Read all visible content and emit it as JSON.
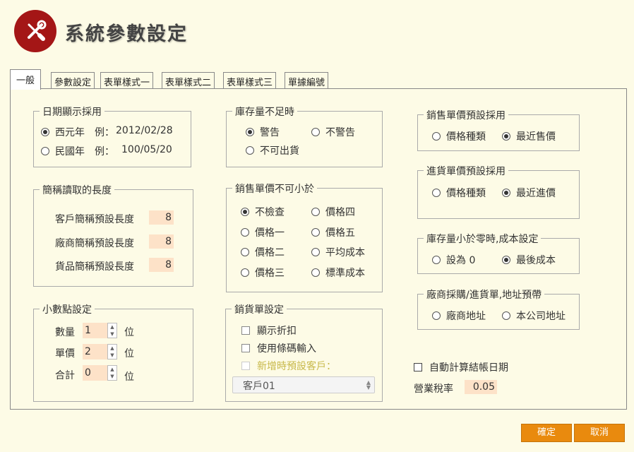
{
  "header": {
    "title": "系統參數設定",
    "logo_icon": "tools-icon",
    "logo_color": "#a41616"
  },
  "tabs": [
    "一般",
    "參數設定",
    "表單樣式一",
    "表單樣式二",
    "表單樣式三",
    "單據編號"
  ],
  "date_display": {
    "legend": "日期顯示採用",
    "options": [
      {
        "label": "西元年",
        "example_label": "例：",
        "example": "2012/02/28",
        "selected": true
      },
      {
        "label": "民國年",
        "example_label": "例：",
        "example": "100/05/20",
        "selected": false
      }
    ]
  },
  "short_name": {
    "legend": "簡稱讀取的長度",
    "rows": [
      {
        "label": "客戶簡稱預設長度",
        "value": "8"
      },
      {
        "label": "廠商簡稱預設長度",
        "value": "8"
      },
      {
        "label": "貨品簡稱預設長度",
        "value": "8"
      }
    ]
  },
  "decimal": {
    "legend": "小數點設定",
    "unit": "位",
    "rows": [
      {
        "label": "數量",
        "value": "1"
      },
      {
        "label": "單價",
        "value": "2"
      },
      {
        "label": "合計",
        "value": "0"
      }
    ]
  },
  "stock_short": {
    "legend": "庫存量不足時",
    "options": [
      {
        "label": "警告",
        "selected": true
      },
      {
        "label": "不警告",
        "selected": false
      },
      {
        "label": "不可出貨",
        "selected": false
      }
    ]
  },
  "min_price": {
    "legend": "銷售單價不可小於",
    "options": [
      {
        "label": "不檢查",
        "selected": true
      },
      {
        "label": "價格四",
        "selected": false
      },
      {
        "label": "價格一",
        "selected": false
      },
      {
        "label": "價格五",
        "selected": false
      },
      {
        "label": "價格二",
        "selected": false
      },
      {
        "label": "平均成本",
        "selected": false
      },
      {
        "label": "價格三",
        "selected": false
      },
      {
        "label": "標準成本",
        "selected": false
      }
    ]
  },
  "sales_doc": {
    "legend": "銷貨單設定",
    "checks": [
      {
        "label": "顯示折扣",
        "checked": false
      },
      {
        "label": "使用條碼輸入",
        "checked": false
      },
      {
        "label": "新增時預設客戶：",
        "checked": false,
        "disabled": true
      }
    ],
    "default_customer": "客戶01",
    "disabled_label_color": "#c8b94a"
  },
  "sale_price_default": {
    "legend": "銷售單價預設採用",
    "options": [
      {
        "label": "價格種類",
        "selected": false
      },
      {
        "label": "最近售價",
        "selected": true
      }
    ]
  },
  "purchase_price_default": {
    "legend": "進貨單價預設採用",
    "options": [
      {
        "label": "價格種類",
        "selected": false
      },
      {
        "label": "最近進價",
        "selected": true
      }
    ]
  },
  "negative_stock": {
    "legend": "庫存量小於零時,成本設定",
    "options": [
      {
        "label": "設為 0",
        "selected": false
      },
      {
        "label": "最後成本",
        "selected": true
      }
    ]
  },
  "vendor_address": {
    "legend": "廠商採購/進貨單,地址預帶",
    "options": [
      {
        "label": "廠商地址",
        "selected": false
      },
      {
        "label": "本公司地址",
        "selected": false
      }
    ]
  },
  "auto_close": {
    "label": "自動計算結帳日期",
    "checked": false
  },
  "tax": {
    "label": "營業稅率",
    "value": "0.05"
  },
  "buttons": {
    "ok": "確定",
    "cancel": "取消",
    "color": "#e98a0e"
  }
}
